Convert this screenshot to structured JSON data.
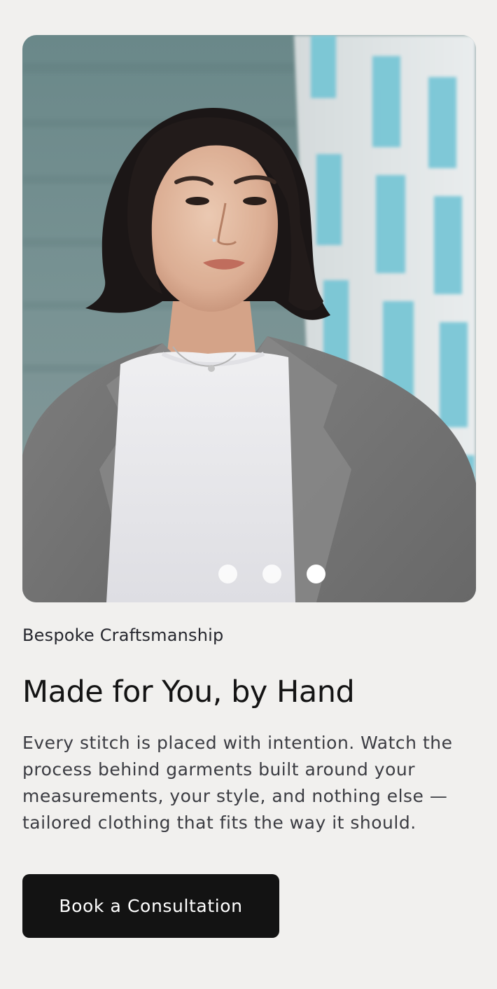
{
  "hero": {
    "image_name": "portrait-photo",
    "carousel": {
      "total": 3,
      "active_index": 2
    }
  },
  "content": {
    "eyebrow": "Bespoke Craftsmanship",
    "headline": "Made for You, by Hand",
    "body": "Every stitch is placed with intention. Watch the process behind garments built around your measurements, your style, and nothing else — tailored clothing that fits the way it should.",
    "cta_label": "Book a Consultation"
  },
  "colors": {
    "background": "#f1f0ee",
    "cta_background": "#131313",
    "cta_text": "#ffffff",
    "headline": "#141414",
    "body": "#3b3c42"
  }
}
